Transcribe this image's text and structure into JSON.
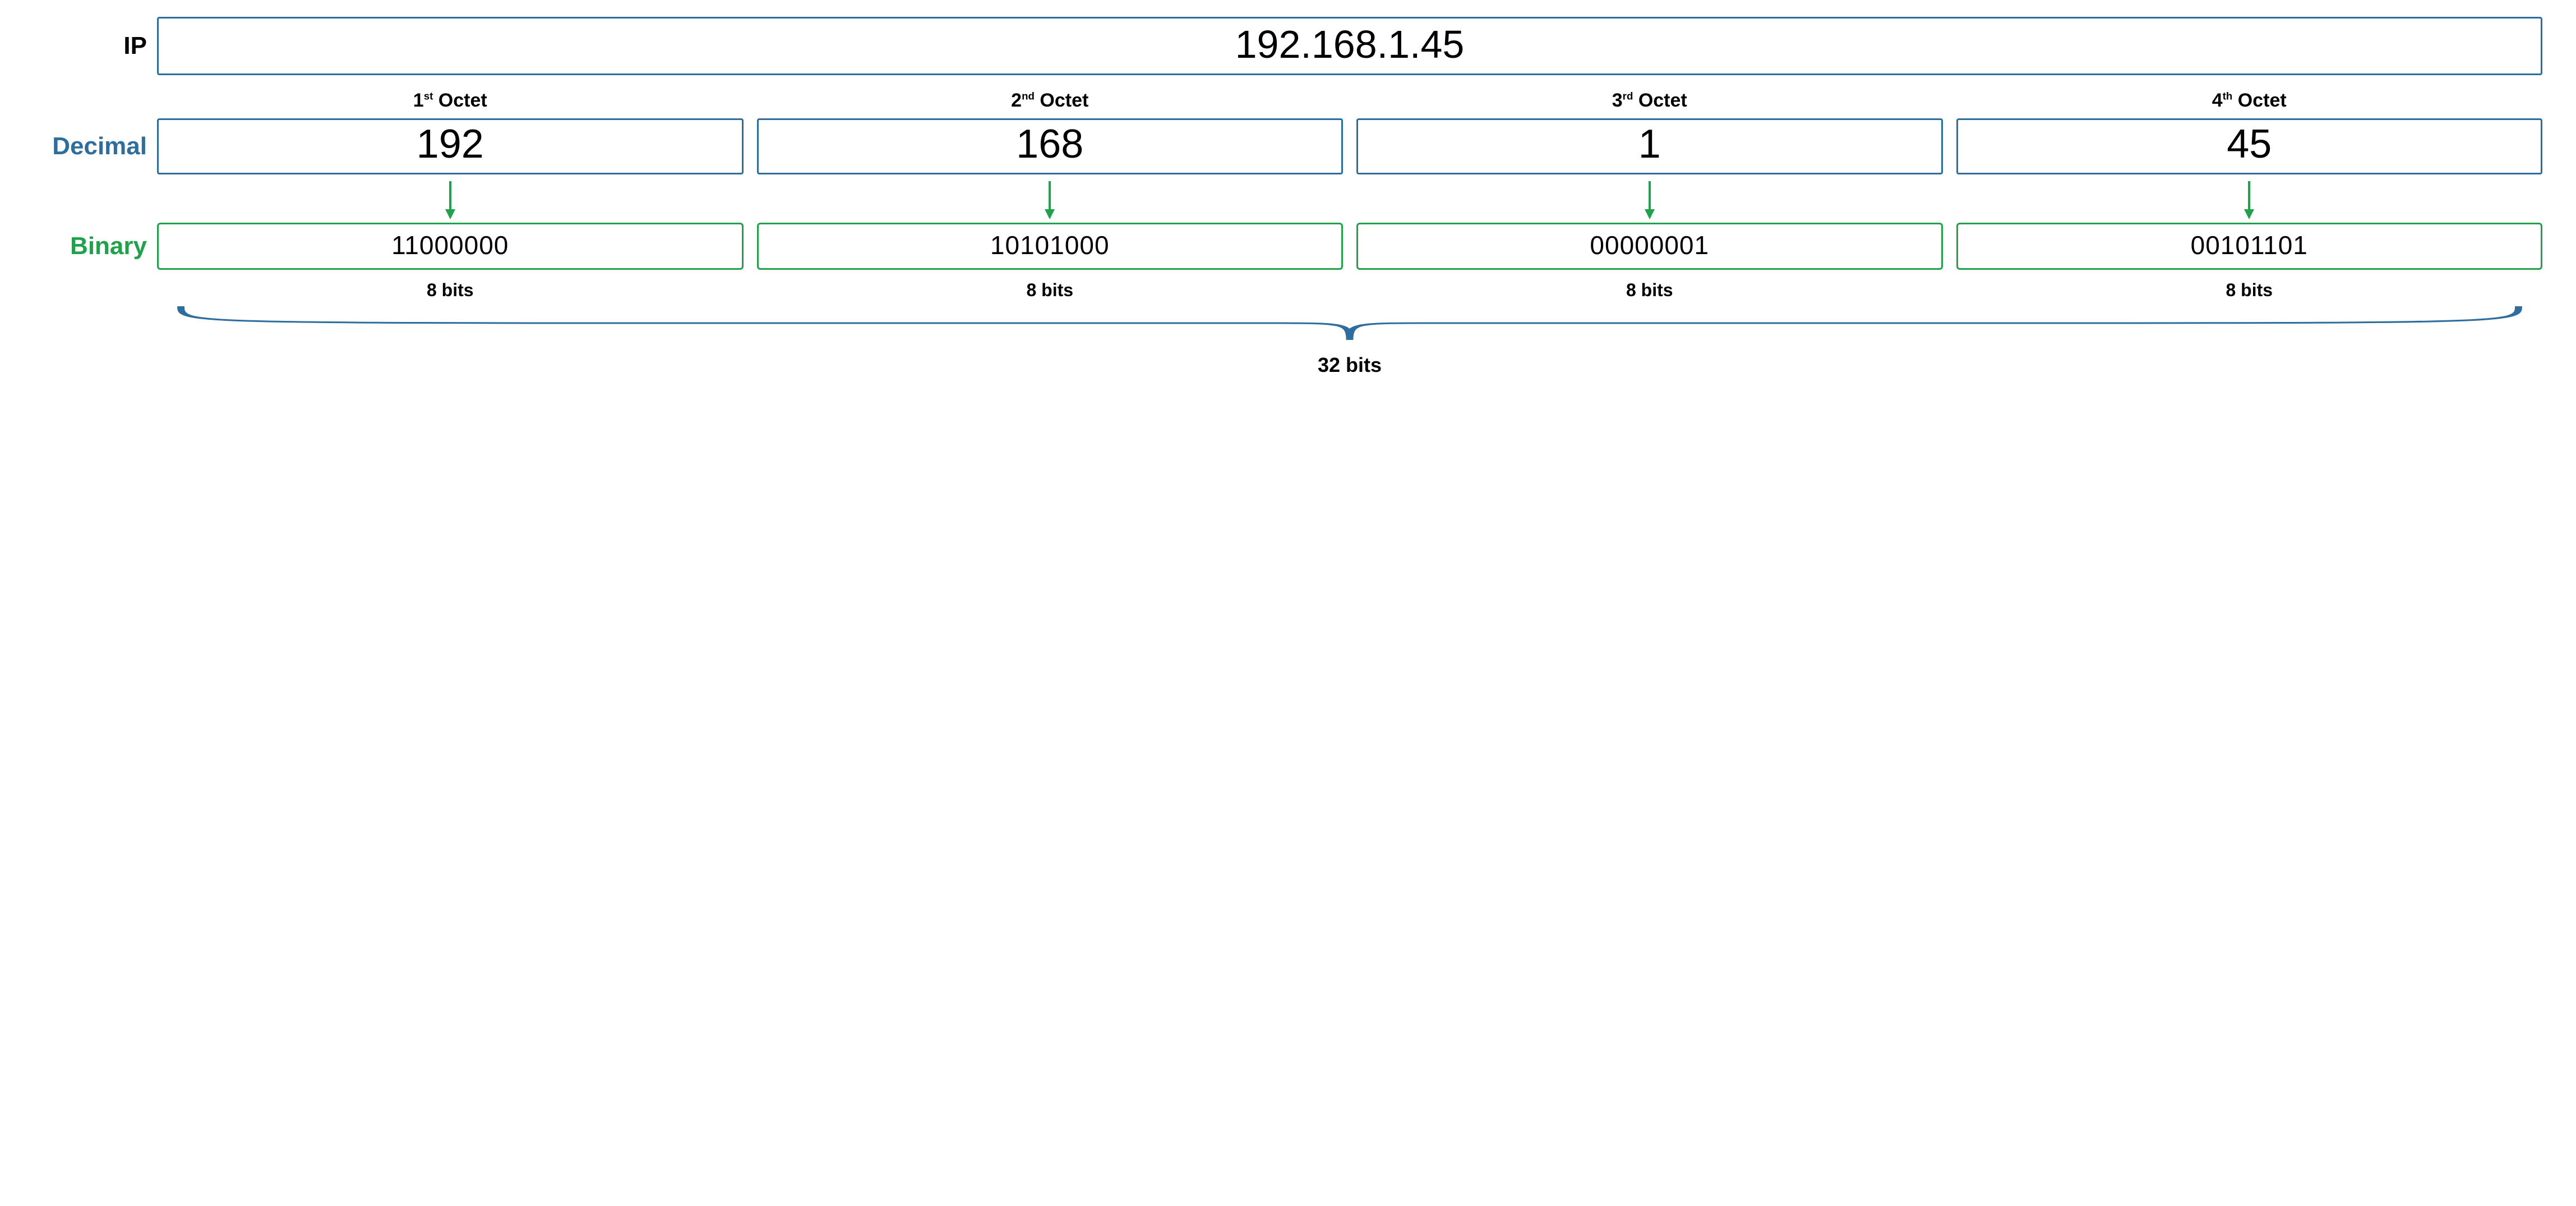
{
  "labels": {
    "ip": "IP",
    "decimal": "Decimal",
    "binary": "Binary"
  },
  "ip_full": "192.168.1.45",
  "octets": [
    {
      "ord": "1",
      "suffix": "st",
      "decimal": "192",
      "binary": "11000000",
      "bits": "8 bits"
    },
    {
      "ord": "2",
      "suffix": "nd",
      "decimal": "168",
      "binary": "10101000",
      "bits": "8 bits"
    },
    {
      "ord": "3",
      "suffix": "rd",
      "decimal": "1",
      "binary": "00000001",
      "bits": "8 bits"
    },
    {
      "ord": "4",
      "suffix": "th",
      "decimal": "45",
      "binary": "00101101",
      "bits": "8 bits"
    }
  ],
  "octet_word": "Octet",
  "total_bits": "32 bits",
  "colors": {
    "blue": "#2e6e9e",
    "green": "#1fa24a"
  }
}
